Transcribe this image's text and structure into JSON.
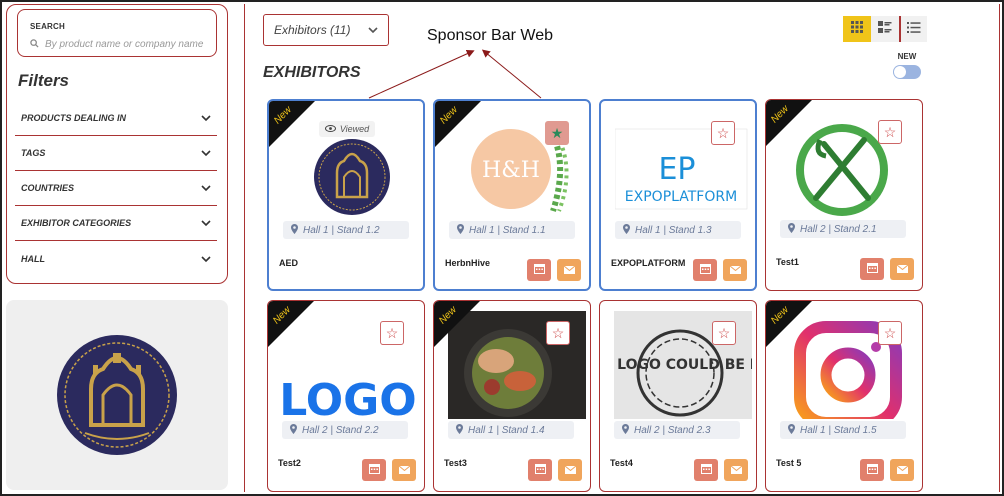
{
  "search": {
    "label": "SEARCH",
    "placeholder": "By product name or company name"
  },
  "filters": {
    "title": "Filters",
    "items": [
      {
        "label": "PRODUCTS DEALING IN"
      },
      {
        "label": "TAGS"
      },
      {
        "label": "COUNTRIES"
      },
      {
        "label": "EXHIBITOR CATEGORIES"
      },
      {
        "label": "HALL"
      }
    ]
  },
  "toolbar": {
    "exhibitor_select": "Exhibitors (11)",
    "section_title": "EXHIBITORS",
    "new_label": "NEW",
    "new_toggle_on": false,
    "view_modes": [
      "grid-icon",
      "card-list-icon",
      "list-icon"
    ],
    "active_view": "grid-icon"
  },
  "annotation": {
    "text": "Sponsor Bar Web"
  },
  "colors": {
    "accent": "#a33333",
    "highlight": "#4d7fd0",
    "calendar_button": "#e1806c",
    "mail_button": "#f0a55c",
    "active_view": "#f0c419"
  },
  "exhibitors": [
    {
      "name": "AED",
      "location": "Hall 1 | Stand 1.2",
      "new": true,
      "highlighted": true,
      "favorite": false,
      "viewed": "Viewed",
      "logo": "awadh-dastarkhwan-logo"
    },
    {
      "name": "HerbnHive",
      "location": "Hall 1 | Stand 1.1",
      "new": true,
      "highlighted": true,
      "favorite": true,
      "viewed": "",
      "logo": "herbnhive-logo",
      "logo_text": "H&H"
    },
    {
      "name": "EXPOPLATFORM",
      "location": "Hall 1 | Stand 1.3",
      "new": false,
      "highlighted": true,
      "favorite": false,
      "viewed": "",
      "logo": "expoplatform-logo",
      "logo_text": "EXPOPLATFORM"
    },
    {
      "name": "Test1",
      "location": "Hall 2 | Stand 2.1",
      "new": true,
      "highlighted": false,
      "favorite": false,
      "viewed": "",
      "logo": "fork-knife-logo"
    },
    {
      "name": "Test2",
      "location": "Hall 2 | Stand 2.2",
      "new": true,
      "highlighted": false,
      "favorite": false,
      "viewed": "",
      "logo": "logo-text-logo",
      "logo_text": "LOGO"
    },
    {
      "name": "Test3",
      "location": "Hall 1 | Stand 1.4",
      "new": true,
      "highlighted": false,
      "favorite": false,
      "viewed": "",
      "logo": "food-bowl-photo"
    },
    {
      "name": "Test4",
      "location": "Hall 2 | Stand 2.3",
      "new": false,
      "highlighted": false,
      "favorite": false,
      "viewed": "",
      "logo": "your-logo-placeholder",
      "logo_text": "YOUR LOGO COULD BE HERE"
    },
    {
      "name": "Test 5",
      "location": "Hall 1 | Stand 1.5",
      "new": true,
      "highlighted": false,
      "favorite": false,
      "viewed": "",
      "logo": "instagram-logo"
    }
  ],
  "ribbon_text": "New"
}
